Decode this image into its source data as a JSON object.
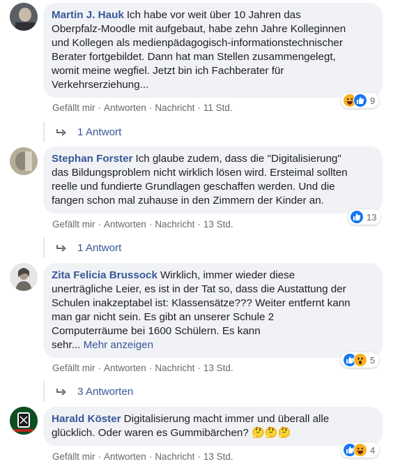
{
  "comments": [
    {
      "author": "Martin J. Hauk",
      "lines": [
        "Ich habe vor weit über 10 Jahren das",
        "Oberpfalz-Moodle mit aufgebaut, habe zehn Jahre Kolleginnen",
        "und Kollegen als medienpädagogisch-informationstechnischer",
        "Berater fortgebildet. Dann hat man Stellen zusammengelegt,",
        "womit meine wegfiel. Jetzt bin ich Fachberater für",
        "Verkehrserziehung..."
      ],
      "more": "",
      "actions": {
        "like": "Gefällt mir",
        "reply": "Antworten",
        "message": "Nachricht",
        "time": "11 Std."
      },
      "reactions": {
        "icons": [
          "haha",
          "like"
        ],
        "count": "9"
      },
      "replies": "1 Antwort"
    },
    {
      "author": "Stephan Forster",
      "lines": [
        "Ich glaube zudem, dass die \"Digitalisierung\"",
        "das Bildungsproblem nicht wirklich lösen wird. Ersteimal sollten",
        "reelle und fundierte Grundlagen geschaffen werden. Und die",
        "fangen schon mal zuhause in den Zimmern der Kinder an."
      ],
      "more": "",
      "actions": {
        "like": "Gefällt mir",
        "reply": "Antworten",
        "message": "Nachricht",
        "time": "13 Std."
      },
      "reactions": {
        "icons": [
          "like"
        ],
        "count": "13"
      },
      "replies": "1 Antwort"
    },
    {
      "author": "Zita Felicia Brussock",
      "lines": [
        "Wirklich, immer wieder diese",
        "unerträgliche Leier, es ist in der Tat so, dass die Austattung der",
        "Schulen inakzeptabel ist: Klassensätze??? Weiter entfernt kann",
        "man gar nicht sein. Es gibt an unserer Schule 2",
        "Computerräume bei 1600 Schülern. Es kann",
        "sehr..."
      ],
      "more": "Mehr anzeigen",
      "actions": {
        "like": "Gefällt mir",
        "reply": "Antworten",
        "message": "Nachricht",
        "time": "13 Std."
      },
      "reactions": {
        "icons": [
          "like",
          "wow"
        ],
        "count": "5"
      },
      "replies": "3 Antworten"
    },
    {
      "author": "Harald Köster",
      "lines": [
        "Digitalisierung macht immer und überall alle",
        "glücklich. Oder waren es Gummibärchen? 🤔🤔🤔"
      ],
      "more": "",
      "actions": {
        "like": "Gefällt mir",
        "reply": "Antworten",
        "message": "Nachricht",
        "time": "13 Std."
      },
      "reactions": {
        "icons": [
          "like",
          "haha"
        ],
        "count": "4"
      },
      "replies": ""
    }
  ],
  "colors": {
    "link": "#385898",
    "bubble": "#f0f2f5",
    "meta": "#65676b",
    "like": "#1877f2",
    "emoji": "#f7b125"
  }
}
